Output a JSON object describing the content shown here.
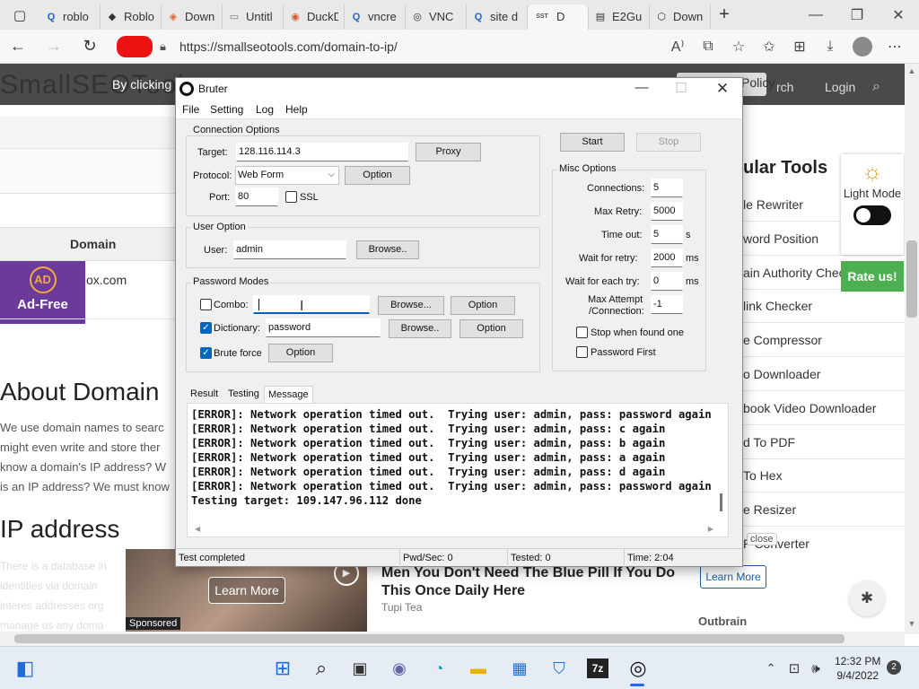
{
  "browser": {
    "tabs": [
      {
        "label": "roblo",
        "icon": "search-icon"
      },
      {
        "label": "Roblo",
        "icon": "roblox-icon"
      },
      {
        "label": "Down",
        "icon": "download-site-icon"
      },
      {
        "label": "Untitl",
        "icon": "blank-page-icon"
      },
      {
        "label": "DuckD",
        "icon": "duckduckgo-icon"
      },
      {
        "label": "vncre",
        "icon": "search-icon"
      },
      {
        "label": "VNC",
        "icon": "vnc-icon"
      },
      {
        "label": "site d",
        "icon": "search-icon"
      },
      {
        "label": "D",
        "icon": "sst-icon",
        "badge": "SST"
      },
      {
        "label": "E2Gu",
        "icon": "document-icon"
      },
      {
        "label": "Down",
        "icon": "package-icon"
      }
    ],
    "url": "https://smallseotools.com/domain-to-ip/"
  },
  "site": {
    "logo": "SmallSEOTools",
    "cookie_text": "By clicking",
    "policy_label": "Policy",
    "nav_search": "rch",
    "nav_login": "Login",
    "domain_header": "Domain",
    "row_text": "ox.com",
    "adfree_circle": "AD",
    "adfree_label": "Ad-Free",
    "about_title": "About Domain",
    "about_lines": [
      "We use domain names to searc",
      "might even write and store ther",
      "know a domain's IP address? W",
      "is an IP address? We must know"
    ],
    "ip_title": "IP address",
    "tools_title": "ular Tools",
    "tools": [
      "le Rewriter",
      "word Position",
      "ain Authority Chec",
      "link Checker",
      "e Compressor",
      "o Downloader",
      "book Video Downloader",
      "d To PDF",
      "To Hex",
      "e Resizer",
      "F Converter"
    ],
    "lightmode_label": "Light Mode",
    "rateus": "Rate us!",
    "close_label": "close",
    "left_ad_lines": [
      "There is a database in",
      "identities via domain",
      "interes addresses org",
      "manage us any doma"
    ]
  },
  "ad": {
    "learn_more_image": "Learn More",
    "sponsored": "Sponsored",
    "headline": "Men You Don't Need The Blue Pill If You Do This Once Daily Here",
    "source": "Tupi Tea",
    "learn_more": "Learn More",
    "outbrain": "Outbrain"
  },
  "bruter": {
    "title": "Bruter",
    "menu": [
      "File",
      "Setting",
      "Log",
      "Help"
    ],
    "connection": {
      "group_title": "Connection Options",
      "target_label": "Target:",
      "target_value": "128.116.114.3",
      "proxy_button": "Proxy",
      "protocol_label": "Protocol:",
      "protocol_value": "Web Form",
      "option_button": "Option",
      "port_label": "Port:",
      "port_value": "80",
      "ssl_label": "SSL",
      "ssl_checked": false
    },
    "user": {
      "group_title": "User Option",
      "user_label": "User:",
      "user_value": "admin",
      "browse_button": "Browse.."
    },
    "password": {
      "group_title": "Password Modes",
      "combo_label": "Combo:",
      "combo_checked": false,
      "combo_value": "",
      "combo_browse": "Browse...",
      "combo_option": "Option",
      "dictionary_label": "Dictionary:",
      "dictionary_checked": true,
      "dictionary_value": "password",
      "dictionary_browse": "Browse..",
      "dictionary_option": "Option",
      "brute_label": "Brute force",
      "brute_checked": true,
      "brute_option": "Option"
    },
    "controls": {
      "start": "Start",
      "stop": "Stop"
    },
    "misc": {
      "group_title": "Misc Options",
      "connections_label": "Connections:",
      "connections_value": "5",
      "max_retry_label": "Max Retry:",
      "max_retry_value": "5000",
      "timeout_label": "Time out:",
      "timeout_value": "5",
      "timeout_unit": "s",
      "wait_retry_label": "Wait for retry:",
      "wait_retry_value": "2000",
      "wait_retry_unit": "ms",
      "wait_try_label": "Wait for each try:",
      "wait_try_value": "0",
      "wait_try_unit": "ms",
      "max_attempt_label_1": "Max Attempt",
      "max_attempt_label_2": "/Connection:",
      "max_attempt_value": "-1",
      "stop_found_label": "Stop when found one",
      "password_first_label": "Password First"
    },
    "tabs": [
      "Result",
      "Testing",
      "Message"
    ],
    "active_tab": "Message",
    "log_lines": [
      "[ERROR]: Network operation timed out.  Trying user: admin, pass: password again",
      "[ERROR]: Network operation timed out.  Trying user: admin, pass: c again",
      "[ERROR]: Network operation timed out.  Trying user: admin, pass: b again",
      "[ERROR]: Network operation timed out.  Trying user: admin, pass: a again",
      "[ERROR]: Network operation timed out.  Trying user: admin, pass: d again",
      "[ERROR]: Network operation timed out.  Trying user: admin, pass: password again",
      "Testing target: 109.147.96.112 done"
    ],
    "status": {
      "state": "Test completed",
      "pwd_sec": "Pwd/Sec: 0",
      "tested": "Tested: 0",
      "time": "Time: 2:04"
    }
  },
  "taskbar": {
    "time": "12:32 PM",
    "date": "9/4/2022",
    "notifications": "2",
    "sevenzip_label": "7z"
  }
}
